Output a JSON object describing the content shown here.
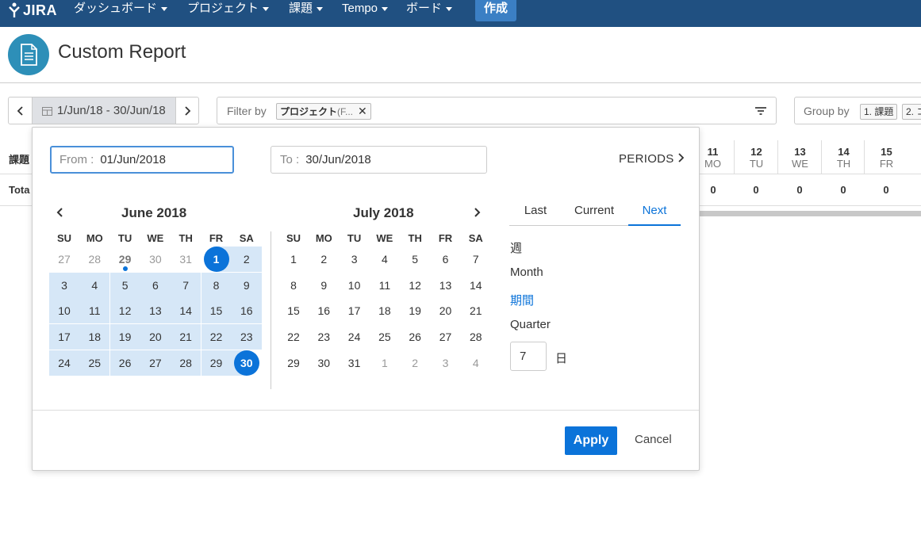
{
  "nav": {
    "logo": "JIRA",
    "items": [
      {
        "label": "ダッシュボード"
      },
      {
        "label": "プロジェクト"
      },
      {
        "label": "課題"
      },
      {
        "label": "Tempo"
      },
      {
        "label": "ボード"
      }
    ],
    "create": "作成",
    "bg_color": "#205081"
  },
  "header": {
    "title": "Custom Report"
  },
  "toolbar": {
    "range": "1/Jun/18 - 30/Jun/18",
    "filter_label": "Filter by",
    "filter_chip_name": "プロジェクト",
    "filter_chip_rest": "(F...",
    "group_label": "Group by",
    "group_chips": [
      "1. 課題",
      "2. コ"
    ]
  },
  "table": {
    "header_label": "課題",
    "total_label": "Tota",
    "days": [
      {
        "num": "11",
        "dow": "MO",
        "total": "0"
      },
      {
        "num": "12",
        "dow": "TU",
        "total": "0"
      },
      {
        "num": "13",
        "dow": "WE",
        "total": "0"
      },
      {
        "num": "14",
        "dow": "TH",
        "total": "0"
      },
      {
        "num": "15",
        "dow": "FR",
        "total": "0"
      }
    ]
  },
  "picker": {
    "from_label": "From :",
    "from_value": "01/Jun/2018",
    "to_label": "To :",
    "to_value": "30/Jun/2018",
    "periods": "PERIODS",
    "dow": [
      "SU",
      "MO",
      "TU",
      "WE",
      "TH",
      "FR",
      "SA"
    ],
    "months": [
      {
        "title": "June 2018",
        "weeks": [
          [
            "27",
            "28",
            "29",
            "30",
            "31",
            "1",
            "2"
          ],
          [
            "3",
            "4",
            "5",
            "6",
            "7",
            "8",
            "9"
          ],
          [
            "10",
            "11",
            "12",
            "13",
            "14",
            "15",
            "16"
          ],
          [
            "17",
            "18",
            "19",
            "20",
            "21",
            "22",
            "23"
          ],
          [
            "24",
            "25",
            "26",
            "27",
            "28",
            "29",
            "30"
          ]
        ]
      },
      {
        "title": "July 2018",
        "weeks": [
          [
            "1",
            "2",
            "3",
            "4",
            "5",
            "6",
            "7"
          ],
          [
            "8",
            "9",
            "10",
            "11",
            "12",
            "13",
            "14"
          ],
          [
            "15",
            "16",
            "17",
            "18",
            "19",
            "20",
            "21"
          ],
          [
            "22",
            "23",
            "24",
            "25",
            "26",
            "27",
            "28"
          ],
          [
            "29",
            "30",
            "31",
            "1",
            "2",
            "3",
            "4"
          ]
        ]
      }
    ],
    "tabs": [
      "Last",
      "Current",
      "Next"
    ],
    "active_tab": "Next",
    "options": [
      "週",
      "Month",
      "期間",
      "Quarter"
    ],
    "active_option": "期間",
    "days_value": "7",
    "days_unit": "日",
    "apply": "Apply",
    "cancel": "Cancel",
    "accent": "#0b73d9",
    "range_bg": "#d6e7f7"
  }
}
